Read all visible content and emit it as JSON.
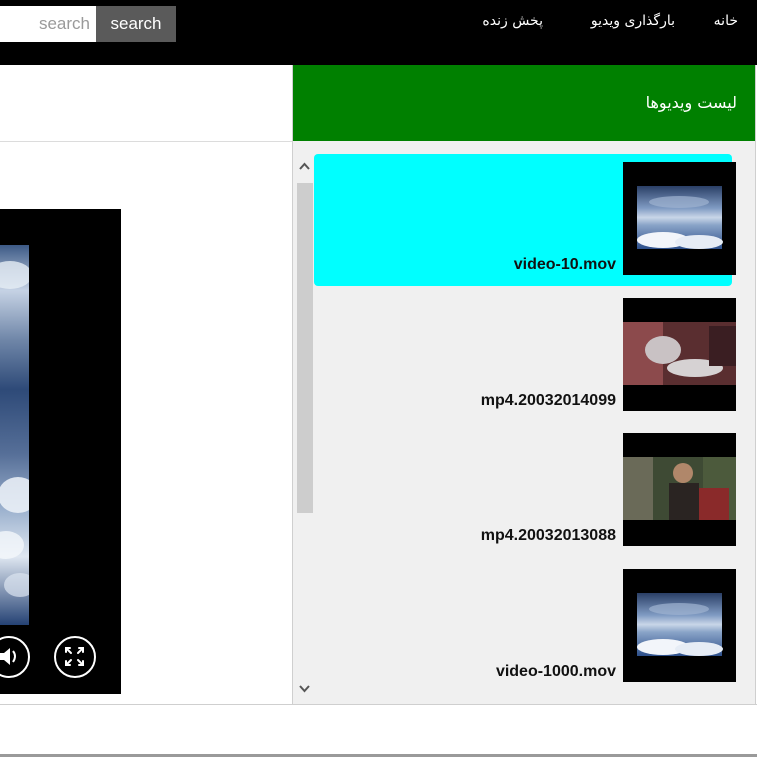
{
  "header": {
    "search_placeholder": "search",
    "search_button": "search",
    "nav": [
      {
        "label": "خانه"
      },
      {
        "label": "بارگذاری ویدیو"
      },
      {
        "label": "پخش زنده"
      }
    ]
  },
  "panel": {
    "title": "لیست ویدیوها",
    "videos": [
      {
        "name": "video-10.mov",
        "selected": true,
        "thumb": "sky-clouds"
      },
      {
        "name": "mp4.20032014099",
        "selected": false,
        "thumb": "indoor-scene"
      },
      {
        "name": "mp4.20032013088",
        "selected": false,
        "thumb": "person-scene"
      },
      {
        "name": "video-1000.mov",
        "selected": false,
        "thumb": "sky-clouds"
      }
    ]
  },
  "player": {
    "controls": [
      "volume-icon",
      "fullscreen-icon"
    ]
  },
  "colors": {
    "topbar": "#000000",
    "panel_header": "#008000",
    "selected_item": "#00ffff",
    "search_button": "#5a5a5a"
  }
}
